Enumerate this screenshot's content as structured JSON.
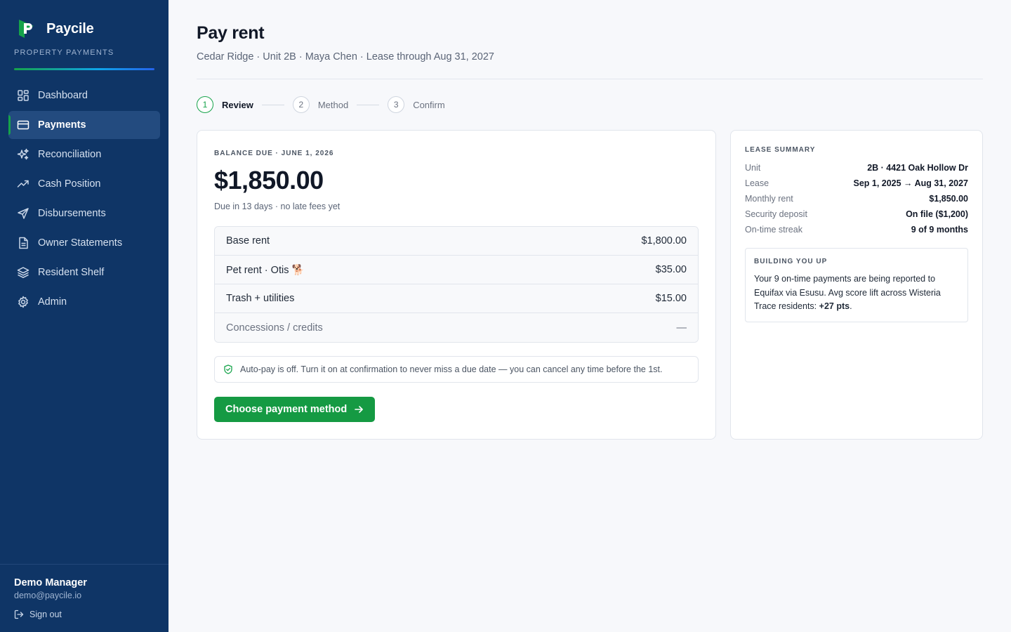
{
  "brand": {
    "name": "Paycile",
    "subtitle": "PROPERTY PAYMENTS",
    "colors": {
      "sidebar": "#0f3566",
      "accent": "#159a43"
    }
  },
  "nav": [
    {
      "label": "Dashboard",
      "icon": "dashboard-icon",
      "active": false
    },
    {
      "label": "Payments",
      "icon": "credit-card-icon",
      "active": true
    },
    {
      "label": "Reconciliation",
      "icon": "sparkles-icon",
      "active": false
    },
    {
      "label": "Cash Position",
      "icon": "trending-up-icon",
      "active": false
    },
    {
      "label": "Disbursements",
      "icon": "send-icon",
      "active": false
    },
    {
      "label": "Owner Statements",
      "icon": "document-icon",
      "active": false
    },
    {
      "label": "Resident Shelf",
      "icon": "layers-icon",
      "active": false
    },
    {
      "label": "Admin",
      "icon": "gear-icon",
      "active": false
    }
  ],
  "user": {
    "name": "Demo Manager",
    "email": "demo@paycile.io",
    "signout_label": "Sign out"
  },
  "page": {
    "title": "Pay rent",
    "subtitle": "Cedar Ridge · Unit 2B · Maya Chen · Lease through Aug 31, 2027"
  },
  "steps": [
    {
      "num": "1",
      "label": "Review",
      "active": true
    },
    {
      "num": "2",
      "label": "Method",
      "active": false
    },
    {
      "num": "3",
      "label": "Confirm",
      "active": false
    }
  ],
  "balance": {
    "label": "BALANCE DUE · JUNE 1, 2026",
    "amount": "$1,850.00",
    "note": "Due in 13 days · no late fees yet",
    "lines": [
      {
        "desc": "Base rent",
        "amount": "$1,800.00"
      },
      {
        "desc": "Pet rent · Otis 🐕",
        "amount": "$35.00"
      },
      {
        "desc": "Trash + utilities",
        "amount": "$15.00"
      },
      {
        "desc": "Concessions / credits",
        "amount": "—"
      }
    ],
    "notice": "Auto-pay is off. Turn it on at confirmation to never miss a due date — you can cancel any time before the 1st.",
    "cta_label": "Choose payment method"
  },
  "lease_summary": {
    "title": "LEASE SUMMARY",
    "rows": [
      {
        "key": "Unit",
        "value": "2B · 4421 Oak Hollow Dr"
      },
      {
        "key": "Lease",
        "value": "Sep 1, 2025 → Aug 31, 2027"
      },
      {
        "key": "Monthly rent",
        "value": "$1,850.00"
      },
      {
        "key": "Security deposit",
        "value": "On file ($1,200)"
      },
      {
        "key": "On-time streak",
        "value": "9 of 9 months"
      }
    ],
    "callout": {
      "title": "BUILDING YOU UP",
      "body": "Your 9 on-time payments are being reported to Equifax via Esusu. Avg score lift across Wisteria Trace residents: ",
      "highlight": "+27 pts",
      "end": "."
    }
  }
}
